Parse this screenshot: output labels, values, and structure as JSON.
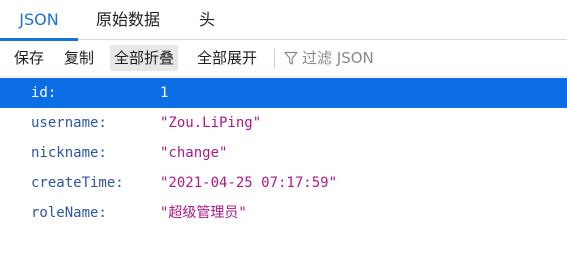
{
  "tabs": [
    {
      "label": "JSON"
    },
    {
      "label": "原始数据"
    },
    {
      "label": "头"
    }
  ],
  "toolbar": {
    "save_label": "保存",
    "copy_label": "复制",
    "collapse_all_label": "全部折叠",
    "expand_all_label": "全部展开",
    "filter_placeholder": "过滤 JSON",
    "filter_icon": "funnel-icon"
  },
  "rows": [
    {
      "key": "id:",
      "value": "1",
      "selected": true
    },
    {
      "key": "username:",
      "value": "\"Zou.LiPing\""
    },
    {
      "key": "nickname:",
      "value": "\"change\""
    },
    {
      "key": "createTime:",
      "value": "\"2021-04-25 07:17:59\""
    },
    {
      "key": "roleName:",
      "value": "\"超级管理员\""
    }
  ],
  "colors": {
    "accent": "#1a73d9",
    "selected_row": "#0c6ee5",
    "key_text": "#2c56a6",
    "string_value": "#b0188a"
  }
}
